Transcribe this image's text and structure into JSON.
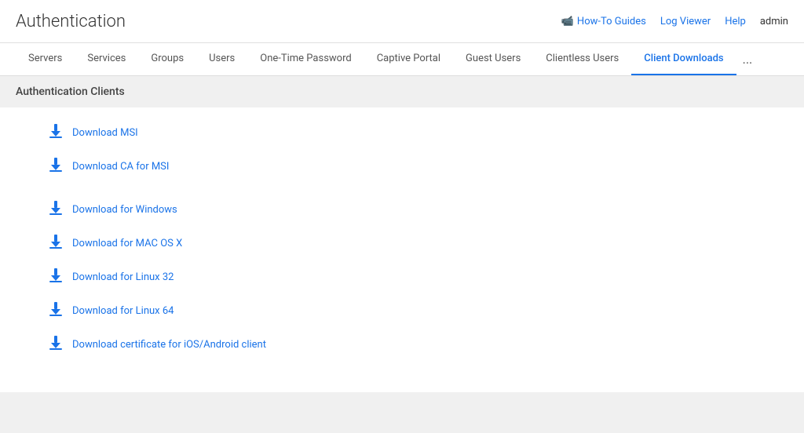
{
  "header": {
    "title": "Authentication",
    "actions": {
      "how_to_guides": "How-To Guides",
      "log_viewer": "Log Viewer",
      "help": "Help",
      "admin": "admin"
    }
  },
  "tabs": {
    "items": [
      {
        "label": "Servers",
        "active": false
      },
      {
        "label": "Services",
        "active": false
      },
      {
        "label": "Groups",
        "active": false
      },
      {
        "label": "Users",
        "active": false
      },
      {
        "label": "One-Time Password",
        "active": false
      },
      {
        "label": "Captive Portal",
        "active": false
      },
      {
        "label": "Guest Users",
        "active": false
      },
      {
        "label": "Clientless Users",
        "active": false
      },
      {
        "label": "Client Downloads",
        "active": true
      }
    ],
    "more_label": "..."
  },
  "main": {
    "section_title": "Authentication Clients",
    "downloads": [
      {
        "label": "Download MSI",
        "group": 1
      },
      {
        "label": "Download CA for MSI",
        "group": 1
      },
      {
        "label": "Download for Windows",
        "group": 2
      },
      {
        "label": "Download for MAC OS X",
        "group": 2
      },
      {
        "label": "Download for Linux 32",
        "group": 2
      },
      {
        "label": "Download for Linux 64",
        "group": 2
      },
      {
        "label": "Download certificate for iOS/Android client",
        "group": 2
      }
    ]
  }
}
